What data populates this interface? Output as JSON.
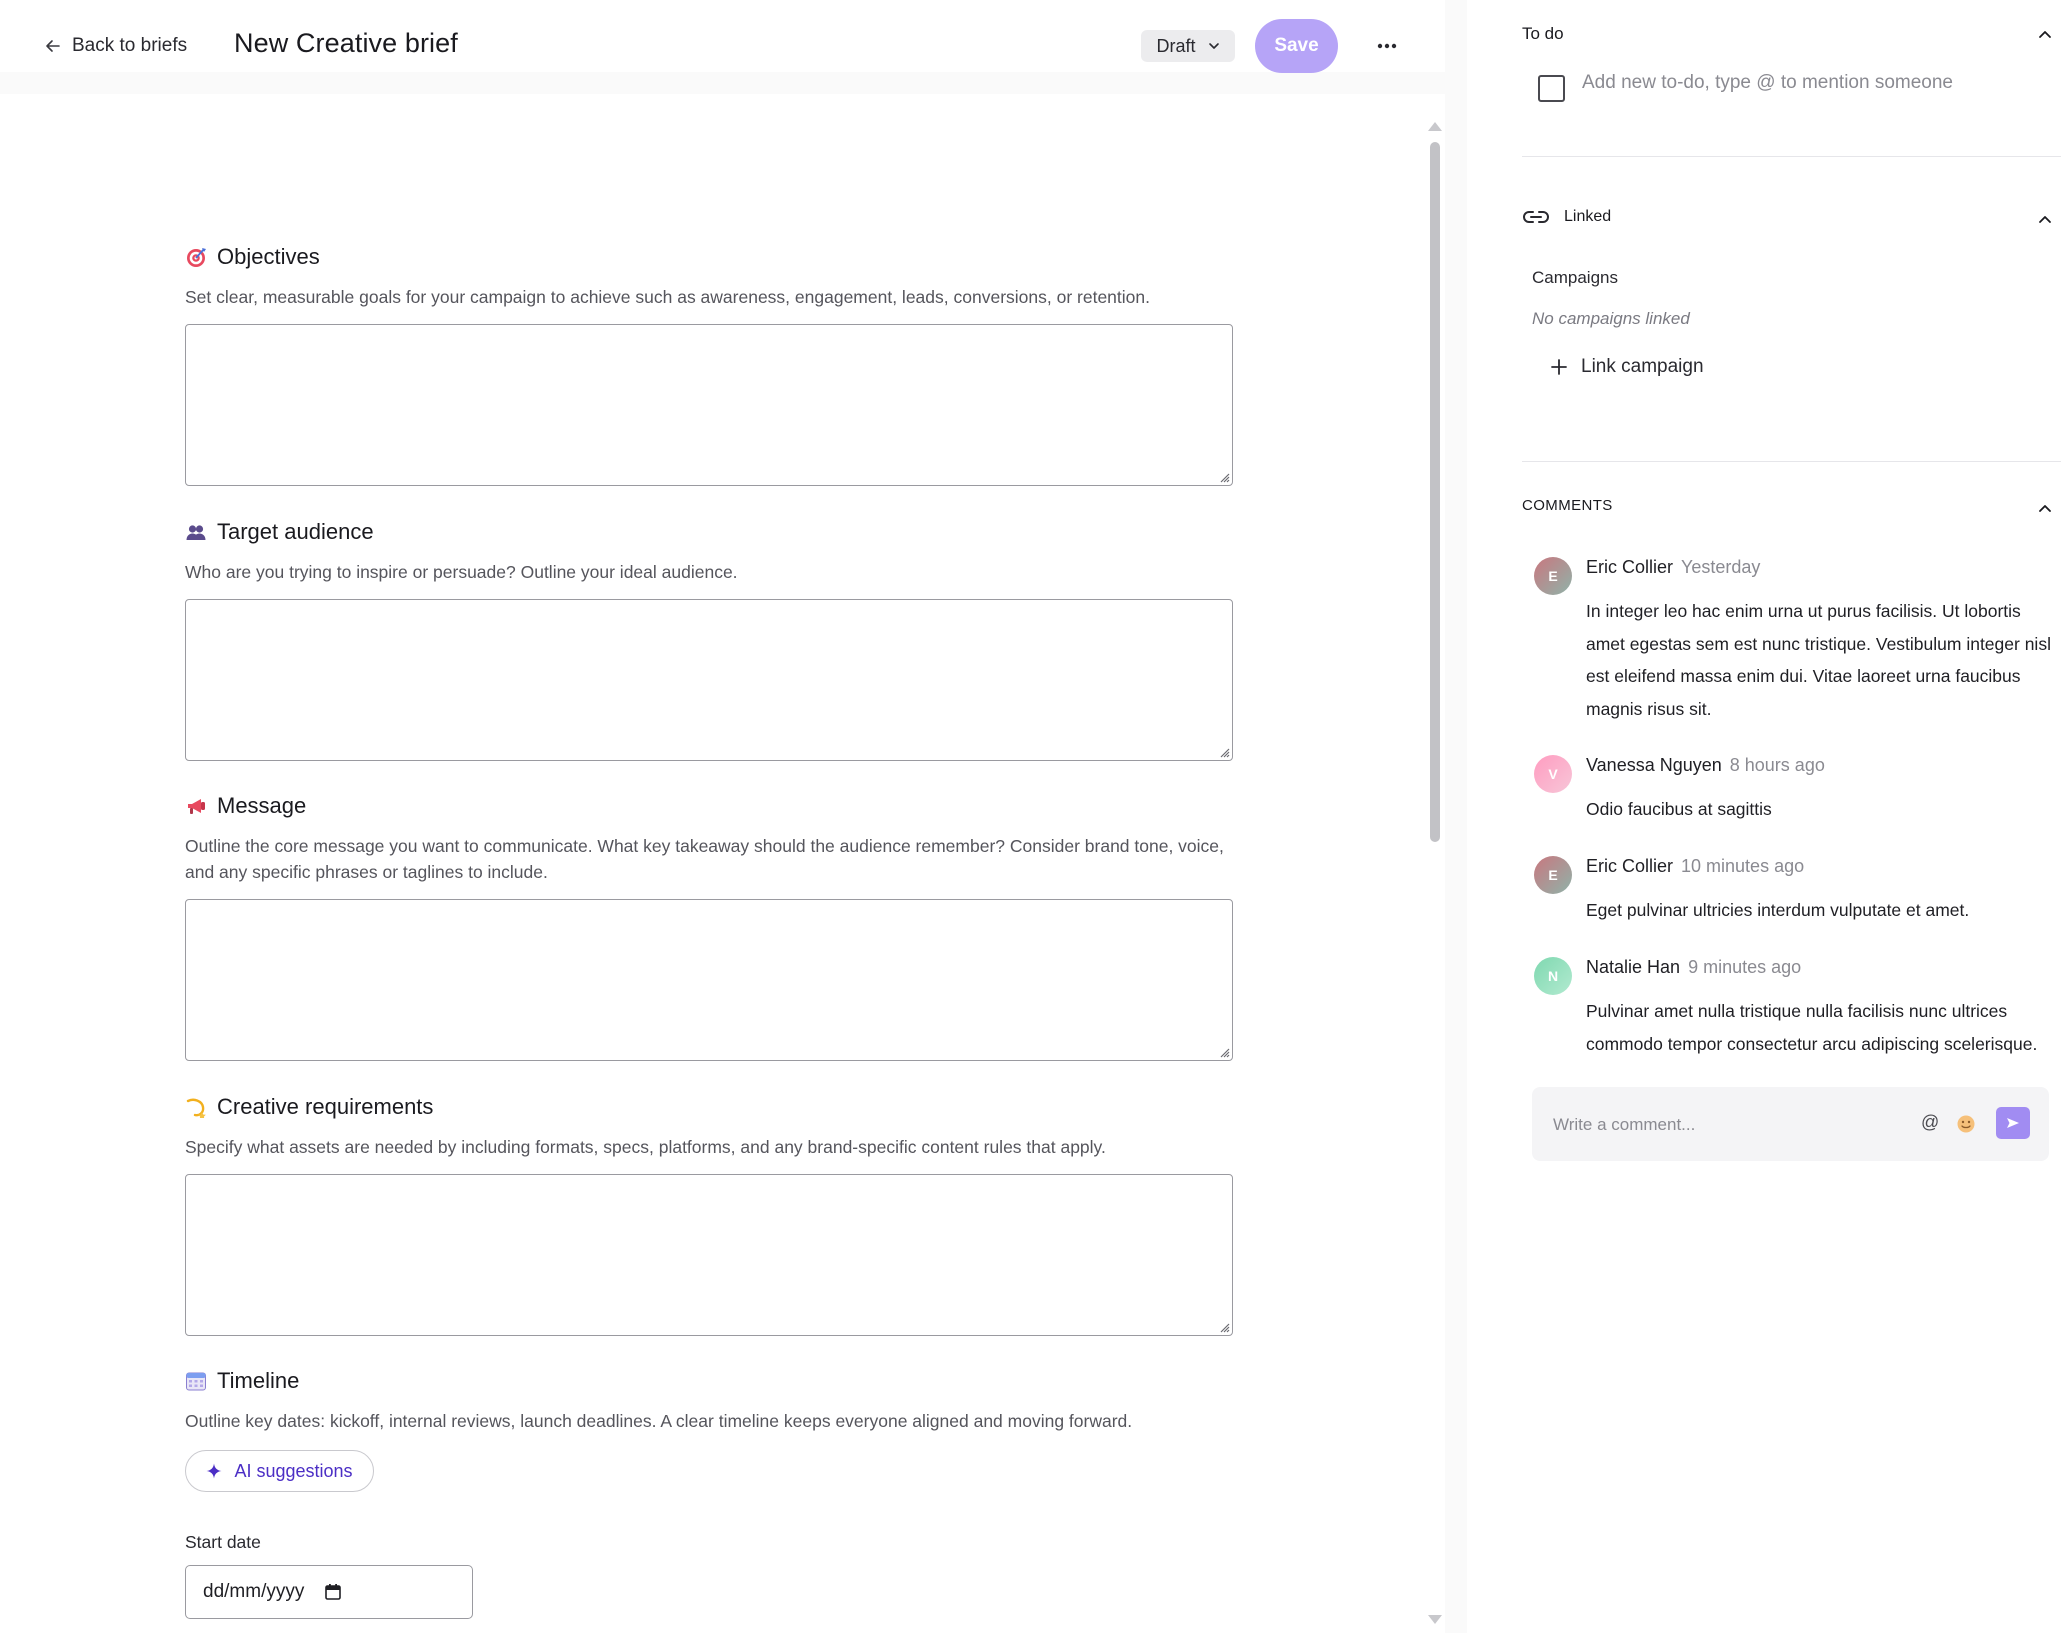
{
  "header": {
    "back_label": "Back to briefs",
    "title": "New Creative brief",
    "status_value": "Draft",
    "save_label": "Save"
  },
  "sections": [
    {
      "icon": "target-icon",
      "title": "Objectives",
      "description": "Set clear, measurable goals for your campaign to achieve such as awareness, engagement, leads, conversions, or retention.",
      "value": ""
    },
    {
      "icon": "people-icon",
      "title": "Target audience",
      "description": "Who are you trying to inspire or persuade? Outline your ideal audience.",
      "value": ""
    },
    {
      "icon": "megaphone-icon",
      "title": "Message",
      "description_line1": "Outline the core message you want to communicate. What key takeaway should the audience remember? Consider brand tone, voice,",
      "description_line2": "and any specific phrases or taglines to include.",
      "value": ""
    },
    {
      "icon": "dizzy-icon",
      "title": "Creative requirements",
      "description": "Specify what assets are needed by including formats, specs, platforms, and any brand-specific content rules that apply.",
      "value": ""
    },
    {
      "icon": "calendar-icon",
      "title": "Timeline",
      "description": "Outline key dates: kickoff, internal reviews, launch deadlines. A clear timeline keeps everyone aligned and moving forward.",
      "ai_button_label": "AI suggestions"
    }
  ],
  "start_date": {
    "label": "Start date",
    "placeholder": "dd/mm/yyyy"
  },
  "sidebar": {
    "todo": {
      "title": "To do",
      "placeholder": "Add new to-do, type @ to mention someone"
    },
    "linked": {
      "title": "Linked",
      "campaigns_label": "Campaigns",
      "empty_text": "No campaigns linked",
      "link_label": "Link campaign"
    },
    "comments": {
      "title": "COMMENTS",
      "items": [
        {
          "initial": "E",
          "author": "Eric Collier",
          "time": "Yesterday",
          "body": "In integer leo hac enim urna ut purus facilisis. Ut lobortis amet egestas sem est nunc tristique. Vestibulum integer nisl est eleifend massa enim dui. Vitae laoreet urna faucibus magnis risus sit.",
          "color": "#b07a86"
        },
        {
          "initial": "V",
          "author": "Vanessa Nguyen",
          "time": "8 hours ago",
          "body": "Odio faucibus at sagittis",
          "color": "#f6a6c5"
        },
        {
          "initial": "E",
          "author": "Eric Collier",
          "time": "10 minutes ago",
          "body": "Eget pulvinar ultricies interdum vulputate et amet.",
          "color": "#b07a86"
        },
        {
          "initial": "N",
          "author": "Natalie Han",
          "time": "9 minutes ago",
          "body": "Pulvinar amet nulla tristique nulla facilisis nunc ultrices commodo tempor consectetur arcu adipiscing scelerisque.",
          "color": "#8fd9b6"
        }
      ],
      "input_placeholder": "Write a comment...",
      "mention_symbol": "@"
    }
  },
  "colors": {
    "accent": "#b6a4f7",
    "send": "#a18cf2",
    "ai_text": "#4b2ec5"
  }
}
